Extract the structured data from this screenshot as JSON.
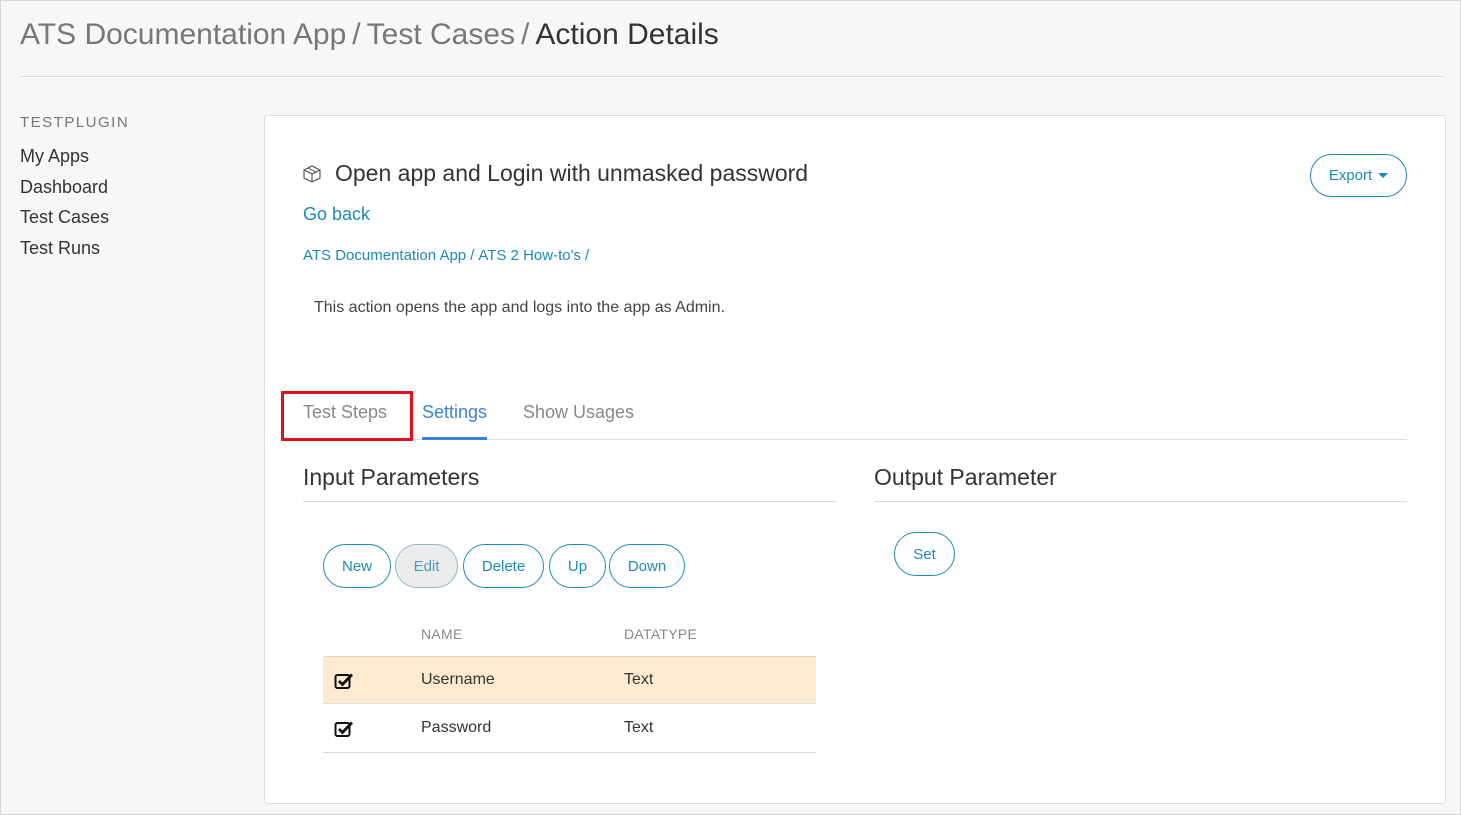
{
  "breadcrumb": {
    "app": "ATS Documentation App",
    "section": "Test Cases",
    "current": "Action Details",
    "separator": "/"
  },
  "sidebar": {
    "heading": "TESTPLUGIN",
    "items": [
      {
        "label": "My Apps"
      },
      {
        "label": "Dashboard"
      },
      {
        "label": "Test Cases"
      },
      {
        "label": "Test Runs"
      }
    ]
  },
  "action": {
    "icon": "cube-icon",
    "title": "Open app and Login with unmasked password",
    "export_label": "Export",
    "go_back": "Go back",
    "path": [
      "ATS Documentation App",
      "ATS 2 How-to's"
    ],
    "path_separator": "/",
    "description": "This action opens the app and logs into the app as Admin."
  },
  "tabs": [
    {
      "label": "Test Steps",
      "active": false
    },
    {
      "label": "Settings",
      "active": true
    },
    {
      "label": "Show Usages",
      "active": false
    }
  ],
  "input_parameters": {
    "title": "Input Parameters",
    "buttons": {
      "new": "New",
      "edit": "Edit",
      "delete": "Delete",
      "up": "Up",
      "down": "Down"
    },
    "columns": {
      "name": "NAME",
      "datatype": "DATATYPE"
    },
    "rows": [
      {
        "name": "Username",
        "datatype": "Text",
        "checked": true,
        "selected": true
      },
      {
        "name": "Password",
        "datatype": "Text",
        "checked": true,
        "selected": false
      }
    ]
  },
  "output_parameter": {
    "title": "Output Parameter",
    "set_label": "Set"
  },
  "colors": {
    "link": "#1a8bb8",
    "active_tab": "#3b82d9",
    "highlight_box": "#e3101a",
    "selected_row": "#fdeacf"
  }
}
